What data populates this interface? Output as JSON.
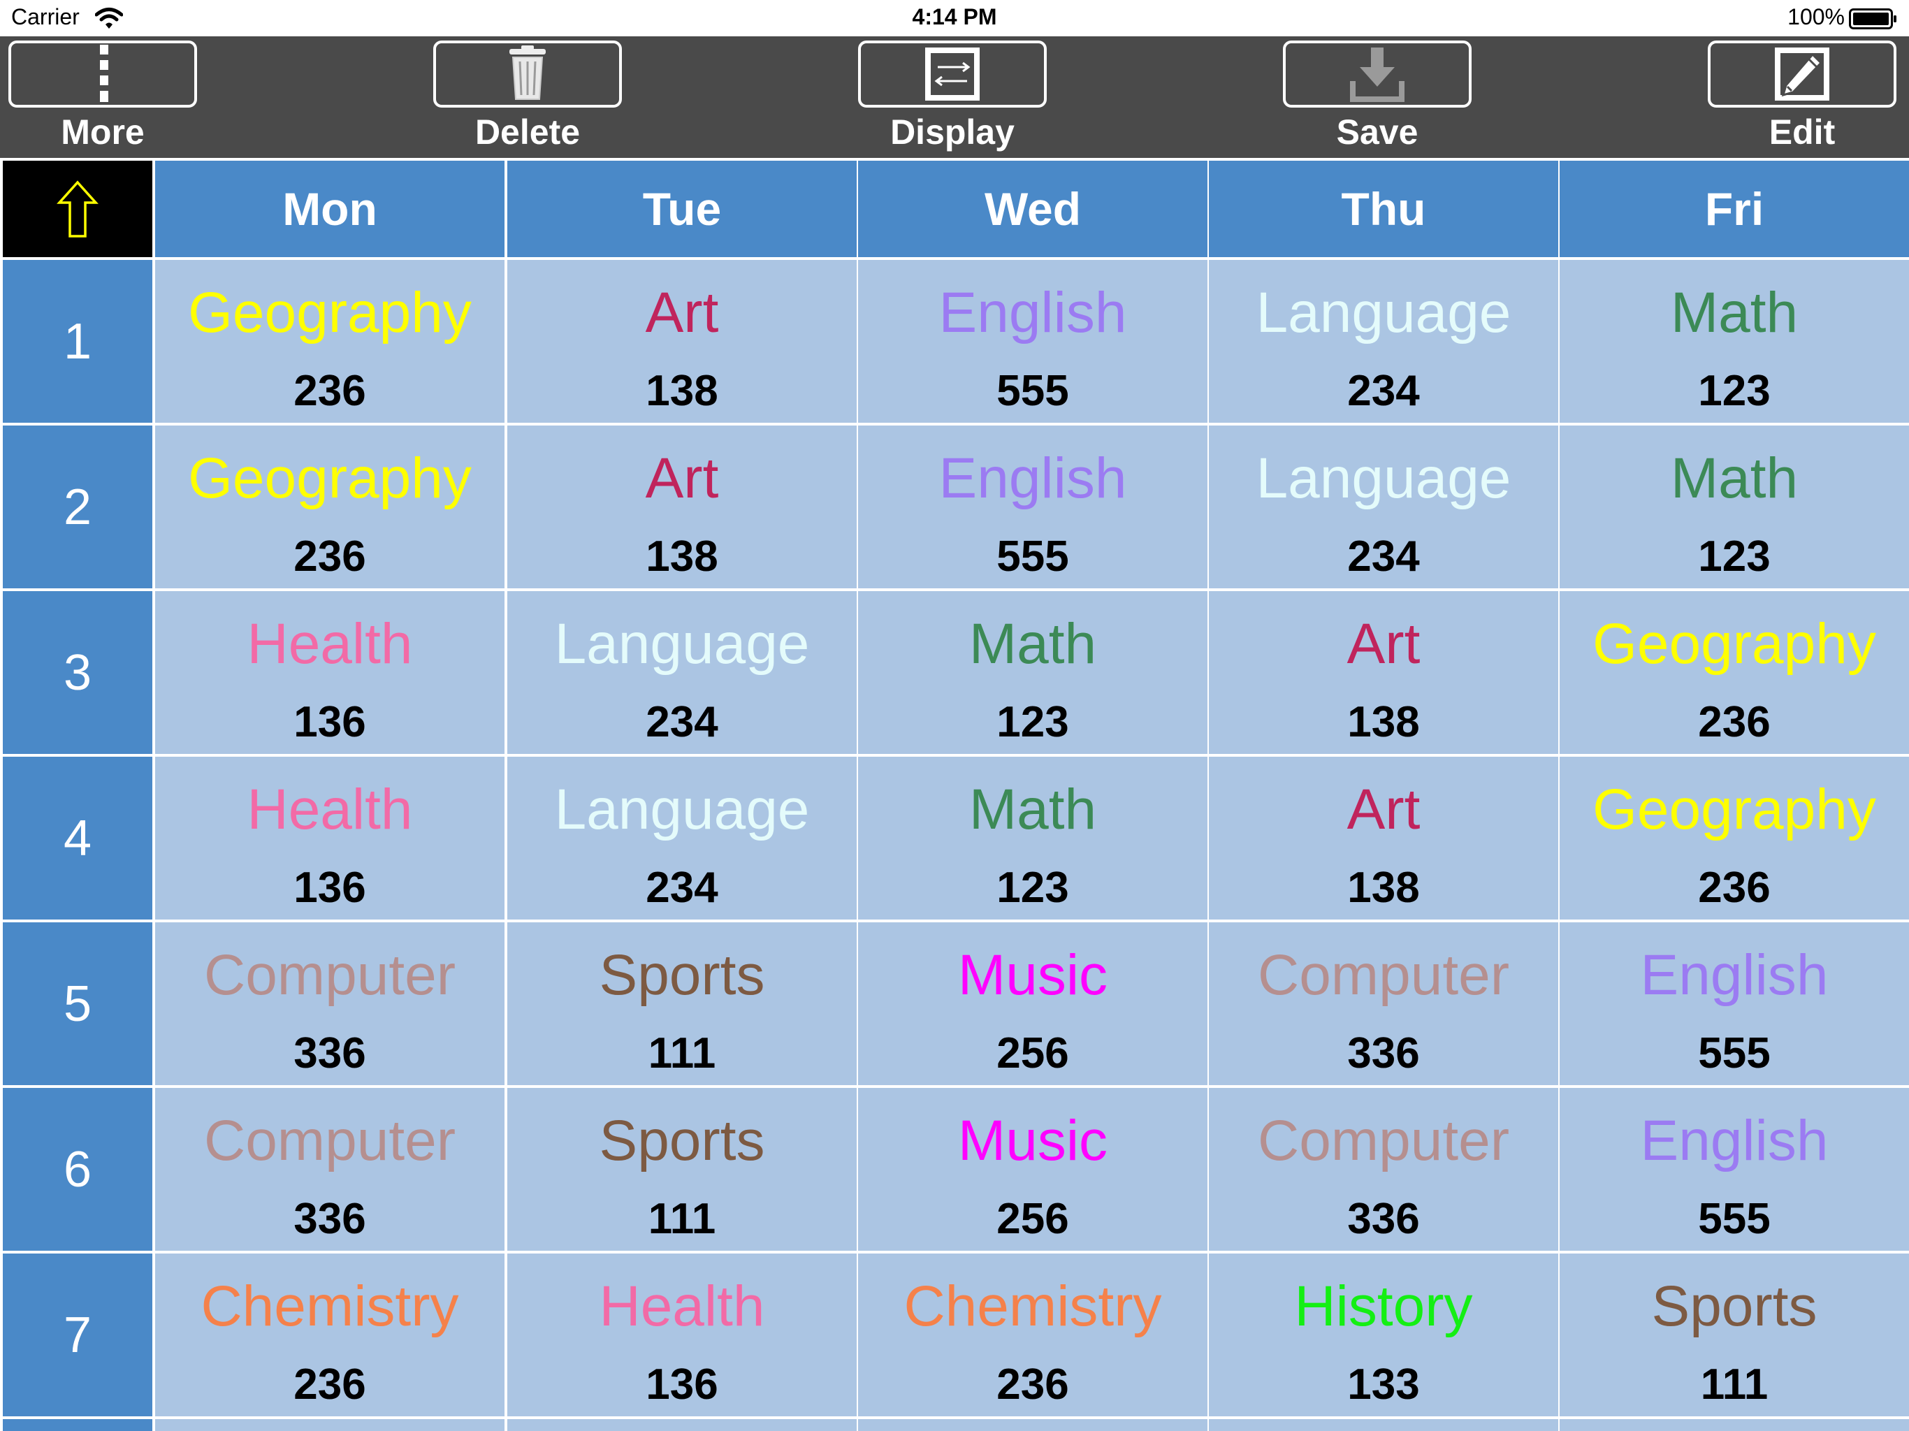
{
  "status_bar": {
    "carrier": "Carrier",
    "time": "4:14 PM",
    "battery": "100%"
  },
  "toolbar": {
    "more_label": "More",
    "delete_label": "Delete",
    "display_label": "Display",
    "save_label": "Save",
    "edit_label": "Edit"
  },
  "colors": {
    "toolbar_bg": "#4a4a4a",
    "header_blue": "#4a89c8",
    "cell_bg": "#abc5e3",
    "corner_bg": "#000000",
    "arrow": "#ffff00"
  },
  "icons": {
    "more": "more-dots-icon",
    "delete": "trash-icon",
    "display": "swap-arrows-icon",
    "save": "download-icon",
    "edit": "pencil-icon",
    "corner": "up-arrow-icon"
  },
  "days": [
    "Mon",
    "Tue",
    "Wed",
    "Thu",
    "Fri"
  ],
  "periods": [
    {
      "number": "1",
      "lessons": [
        {
          "subject": "Geography",
          "room": "236",
          "color": "#ffff00"
        },
        {
          "subject": "Art",
          "room": "138",
          "color": "#c0245c"
        },
        {
          "subject": "English",
          "room": "555",
          "color": "#9b7bf2"
        },
        {
          "subject": "Language",
          "room": "234",
          "color": "#e4fbfb"
        },
        {
          "subject": "Math",
          "room": "123",
          "color": "#3c8a56"
        }
      ]
    },
    {
      "number": "2",
      "lessons": [
        {
          "subject": "Geography",
          "room": "236",
          "color": "#ffff00"
        },
        {
          "subject": "Art",
          "room": "138",
          "color": "#c0245c"
        },
        {
          "subject": "English",
          "room": "555",
          "color": "#9b7bf2"
        },
        {
          "subject": "Language",
          "room": "234",
          "color": "#e4fbfb"
        },
        {
          "subject": "Math",
          "room": "123",
          "color": "#3c8a56"
        }
      ]
    },
    {
      "number": "3",
      "lessons": [
        {
          "subject": "Health",
          "room": "136",
          "color": "#f26aa6"
        },
        {
          "subject": "Language",
          "room": "234",
          "color": "#e4fbfb"
        },
        {
          "subject": "Math",
          "room": "123",
          "color": "#3c8a56"
        },
        {
          "subject": "Art",
          "room": "138",
          "color": "#c0245c"
        },
        {
          "subject": "Geography",
          "room": "236",
          "color": "#ffff00"
        }
      ]
    },
    {
      "number": "4",
      "lessons": [
        {
          "subject": "Health",
          "room": "136",
          "color": "#f26aa6"
        },
        {
          "subject": "Language",
          "room": "234",
          "color": "#e4fbfb"
        },
        {
          "subject": "Math",
          "room": "123",
          "color": "#3c8a56"
        },
        {
          "subject": "Art",
          "room": "138",
          "color": "#c0245c"
        },
        {
          "subject": "Geography",
          "room": "236",
          "color": "#ffff00"
        }
      ]
    },
    {
      "number": "5",
      "lessons": [
        {
          "subject": "Computer",
          "room": "336",
          "color": "#b58f8f"
        },
        {
          "subject": "Sports",
          "room": "111",
          "color": "#7d5a42"
        },
        {
          "subject": "Music",
          "room": "256",
          "color": "#ff00ff"
        },
        {
          "subject": "Computer",
          "room": "336",
          "color": "#b58f8f"
        },
        {
          "subject": "English",
          "room": "555",
          "color": "#9b7bf2"
        }
      ]
    },
    {
      "number": "6",
      "lessons": [
        {
          "subject": "Computer",
          "room": "336",
          "color": "#b58f8f"
        },
        {
          "subject": "Sports",
          "room": "111",
          "color": "#7d5a42"
        },
        {
          "subject": "Music",
          "room": "256",
          "color": "#ff00ff"
        },
        {
          "subject": "Computer",
          "room": "336",
          "color": "#b58f8f"
        },
        {
          "subject": "English",
          "room": "555",
          "color": "#9b7bf2"
        }
      ]
    },
    {
      "number": "7",
      "lessons": [
        {
          "subject": "Chemistry",
          "room": "236",
          "color": "#f5814a"
        },
        {
          "subject": "Health",
          "room": "136",
          "color": "#f26aa6"
        },
        {
          "subject": "Chemistry",
          "room": "236",
          "color": "#f5814a"
        },
        {
          "subject": "History",
          "room": "133",
          "color": "#14ef14"
        },
        {
          "subject": "Sports",
          "room": "111",
          "color": "#7d5a42"
        }
      ]
    }
  ]
}
